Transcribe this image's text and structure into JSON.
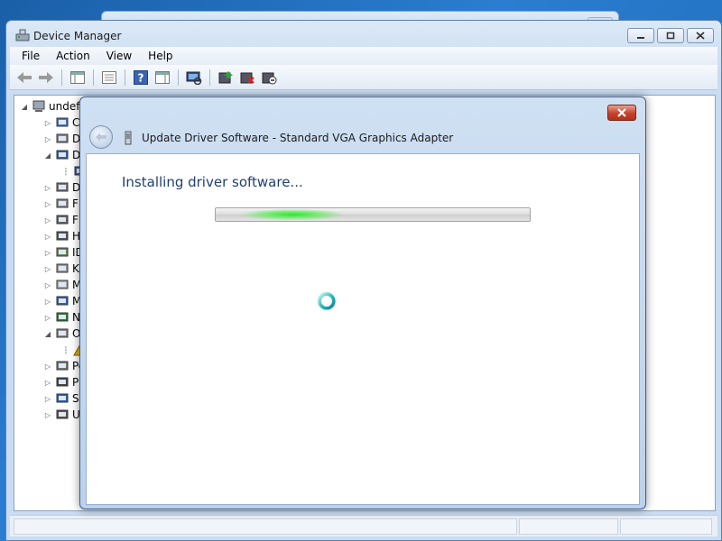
{
  "device_manager": {
    "title": "Device Manager",
    "icon": "device-manager-icon",
    "caption_buttons": [
      "minimize-icon",
      "restore-icon",
      "close-icon"
    ],
    "menu": [
      "File",
      "Action",
      "View",
      "Help"
    ],
    "toolbar_icons": [
      "back-arrow-icon",
      "forward-arrow-icon",
      "show-hide-console-tree-icon",
      "properties-icon",
      "help-icon",
      "show-action-pane-icon",
      "scan-hardware-icon",
      "update-driver-icon",
      "uninstall-device-icon",
      "disable-device-icon"
    ],
    "tree": {
      "root_label": "undef",
      "items": [
        {
          "label": "Co",
          "icon": "computer-icon",
          "expanded": false,
          "level": 1
        },
        {
          "label": "Di",
          "icon": "disk-drives-icon",
          "expanded": false,
          "level": 1
        },
        {
          "label": "Di",
          "icon": "display-adapters-icon",
          "expanded": true,
          "level": 1
        },
        {
          "label": "",
          "icon": "display-adapter-device-icon",
          "expanded": null,
          "level": 2
        },
        {
          "label": "DV",
          "icon": "dvd-drive-icon",
          "expanded": false,
          "level": 1
        },
        {
          "label": "Fl",
          "icon": "floppy-icon",
          "expanded": false,
          "level": 1
        },
        {
          "label": "Fl",
          "icon": "floppy-controller-icon",
          "expanded": false,
          "level": 1
        },
        {
          "label": "Hu",
          "icon": "hid-icon",
          "expanded": false,
          "level": 1
        },
        {
          "label": "ID",
          "icon": "ide-controller-icon",
          "expanded": false,
          "level": 1
        },
        {
          "label": "Ke",
          "icon": "keyboard-icon",
          "expanded": false,
          "level": 1
        },
        {
          "label": "M",
          "icon": "mouse-icon",
          "expanded": false,
          "level": 1
        },
        {
          "label": "M",
          "icon": "monitor-icon",
          "expanded": false,
          "level": 1
        },
        {
          "label": "Ne",
          "icon": "network-adapter-icon",
          "expanded": false,
          "level": 1
        },
        {
          "label": "Ot",
          "icon": "other-devices-icon",
          "expanded": true,
          "level": 1
        },
        {
          "label": "",
          "icon": "unknown-device-warning-icon",
          "expanded": null,
          "level": 2
        },
        {
          "label": "Po",
          "icon": "ports-icon",
          "expanded": false,
          "level": 1
        },
        {
          "label": "Pr",
          "icon": "processor-icon",
          "expanded": false,
          "level": 1
        },
        {
          "label": "Sy",
          "icon": "system-devices-icon",
          "expanded": false,
          "level": 1
        },
        {
          "label": "Ur",
          "icon": "usb-controller-icon",
          "expanded": false,
          "level": 1
        }
      ]
    }
  },
  "dialog": {
    "title": "Update Driver Software - Standard VGA Graphics Adapter",
    "heading": "Installing driver software...",
    "back_icon": "back-arrow-icon",
    "close_icon": "close-icon",
    "progress_style": "indeterminate-marquee",
    "spinner": "busy-spinner-icon"
  },
  "colors": {
    "heading": "#1f3f75",
    "progress_glow": "#34e03a",
    "close_button": "#c7402a"
  }
}
